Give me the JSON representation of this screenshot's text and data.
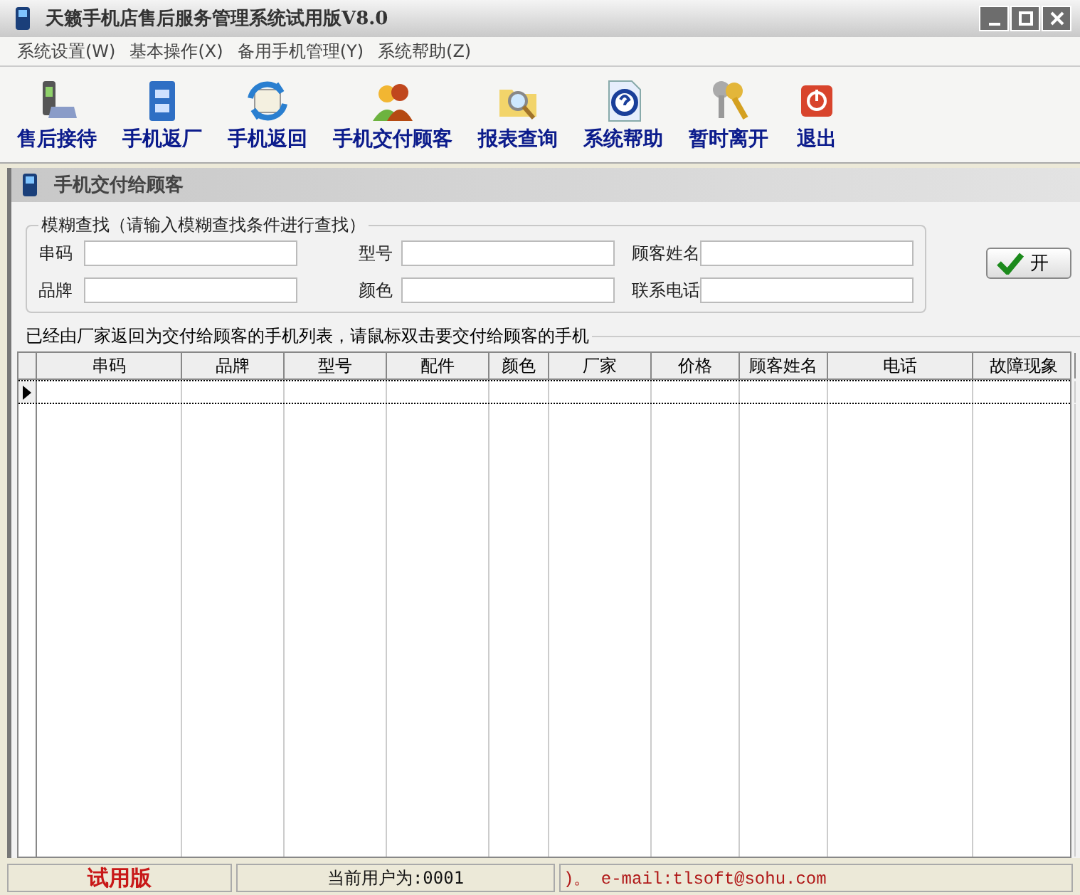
{
  "window": {
    "title": "天籁手机店售后服务管理系统试用版V8.0"
  },
  "menu": [
    {
      "label": "系统设置(W)"
    },
    {
      "label": "基本操作(X)"
    },
    {
      "label": "备用手机管理(Y)"
    },
    {
      "label": "系统帮助(Z)"
    }
  ],
  "toolbar": [
    {
      "label": "售后接待"
    },
    {
      "label": "手机返厂"
    },
    {
      "label": "手机返回"
    },
    {
      "label": "手机交付顾客"
    },
    {
      "label": "报表查询"
    },
    {
      "label": "系统帮助"
    },
    {
      "label": "暂时离开"
    },
    {
      "label": "退出"
    }
  ],
  "child_window": {
    "title": "手机交付给顾客"
  },
  "search_group": {
    "title": "模糊查找（请输入模糊查找条件进行查找）",
    "fields": [
      {
        "label": "串码"
      },
      {
        "label": "型号"
      },
      {
        "label": "顾客姓名"
      },
      {
        "label": "品牌"
      },
      {
        "label": "颜色"
      },
      {
        "label": "联系电话"
      }
    ],
    "button": "开"
  },
  "list_caption": "已经由厂家返回为交付给顾客的手机列表，请鼠标双击要交付给顾客的手机",
  "table": {
    "columns": [
      "串码",
      "品牌",
      "型号",
      "配件",
      "颜色",
      "厂家",
      "价格",
      "顾客姓名",
      "电话",
      "故障现象"
    ],
    "rows": [
      {
        "current": true
      }
    ]
  },
  "status_bar": [
    {
      "kind": "trial",
      "text": "试用版"
    },
    {
      "kind": "user",
      "text": "当前用户为:0001"
    },
    {
      "kind": "email",
      "text": ")。 e-mail:tlsoft@sohu.com"
    }
  ]
}
